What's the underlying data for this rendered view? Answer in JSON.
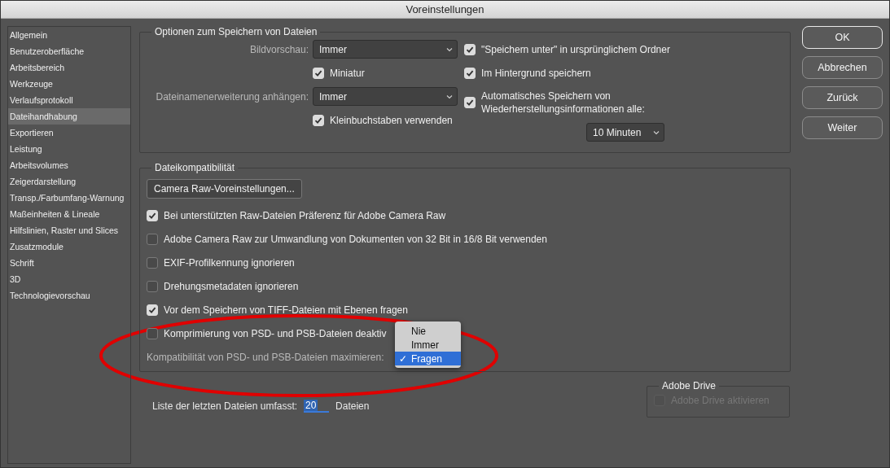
{
  "window": {
    "title": "Voreinstellungen"
  },
  "sidebar": {
    "items": [
      {
        "label": "Allgemein",
        "selected": false
      },
      {
        "label": "Benutzeroberfläche",
        "selected": false
      },
      {
        "label": "Arbeitsbereich",
        "selected": false
      },
      {
        "label": "Werkzeuge",
        "selected": false
      },
      {
        "label": "Verlaufsprotokoll",
        "selected": false
      },
      {
        "label": "Dateihandhabung",
        "selected": true
      },
      {
        "label": "Exportieren",
        "selected": false
      },
      {
        "label": "Leistung",
        "selected": false
      },
      {
        "label": "Arbeitsvolumes",
        "selected": false
      },
      {
        "label": "Zeigerdarstellung",
        "selected": false
      },
      {
        "label": "Transp./Farbumfang-Warnung",
        "selected": false
      },
      {
        "label": "Maßeinheiten & Lineale",
        "selected": false
      },
      {
        "label": "Hilfslinien, Raster und Slices",
        "selected": false
      },
      {
        "label": "Zusatzmodule",
        "selected": false
      },
      {
        "label": "Schrift",
        "selected": false
      },
      {
        "label": "3D",
        "selected": false
      },
      {
        "label": "Technologievorschau",
        "selected": false
      }
    ]
  },
  "save_options": {
    "title": "Optionen zum Speichern von Dateien",
    "image_preview": {
      "label": "Bildvorschau:",
      "value": "Immer"
    },
    "thumbnail": {
      "label": "Miniatur",
      "checked": true
    },
    "extension": {
      "label": "Dateinamenerweiterung anhängen:",
      "value": "Immer"
    },
    "lowercase": {
      "label": "Kleinbuchstaben verwenden",
      "checked": true
    },
    "right_options": [
      {
        "label": "\"Speichern unter\" in ursprünglichem Ordner",
        "checked": true
      },
      {
        "label": "Im Hintergrund speichern",
        "checked": true
      },
      {
        "label": "Automatisches Speichern von Wiederherstellungsinformationen alle:",
        "checked": true
      }
    ],
    "autosave_interval": "10 Minuten"
  },
  "compatibility": {
    "title": "Dateikompatibilität",
    "camera_raw_button": "Camera Raw-Voreinstellungen...",
    "options": [
      {
        "label": "Bei unterstützten Raw-Dateien Präferenz für Adobe Camera Raw",
        "checked": true
      },
      {
        "label": "Adobe Camera Raw zur Umwandlung von Dokumenten von 32 Bit in 16/8 Bit verwenden",
        "checked": false
      },
      {
        "label": "EXIF-Profilkennung ignorieren",
        "checked": false
      },
      {
        "label": "Drehungsmetadaten ignorieren",
        "checked": false
      },
      {
        "label": "Vor dem Speichern von TIFF-Dateien mit Ebenen fragen",
        "checked": true
      },
      {
        "label": "Komprimierung von PSD- und PSB-Dateien deaktiv",
        "checked": false
      }
    ],
    "maximize": {
      "label": "Kompatibilität von PSD- und PSB-Dateien maximieren:",
      "menu": [
        {
          "label": "Nie",
          "selected": false
        },
        {
          "label": "Immer",
          "selected": false
        },
        {
          "label": "Fragen",
          "selected": true
        }
      ],
      "check_mark": "✓"
    }
  },
  "recent_files": {
    "label": "Liste der letzten Dateien umfasst:",
    "value": "20",
    "unit": "Dateien"
  },
  "adobe_drive": {
    "title": "Adobe Drive",
    "option": {
      "label": "Adobe Drive aktivieren",
      "checked": false,
      "disabled": true
    }
  },
  "buttons": [
    {
      "label": "OK",
      "default": true
    },
    {
      "label": "Abbrechen",
      "default": false
    },
    {
      "label": "Zurück",
      "default": false
    },
    {
      "label": "Weiter",
      "default": false
    }
  ],
  "annotation": {
    "kind": "ellipse"
  }
}
